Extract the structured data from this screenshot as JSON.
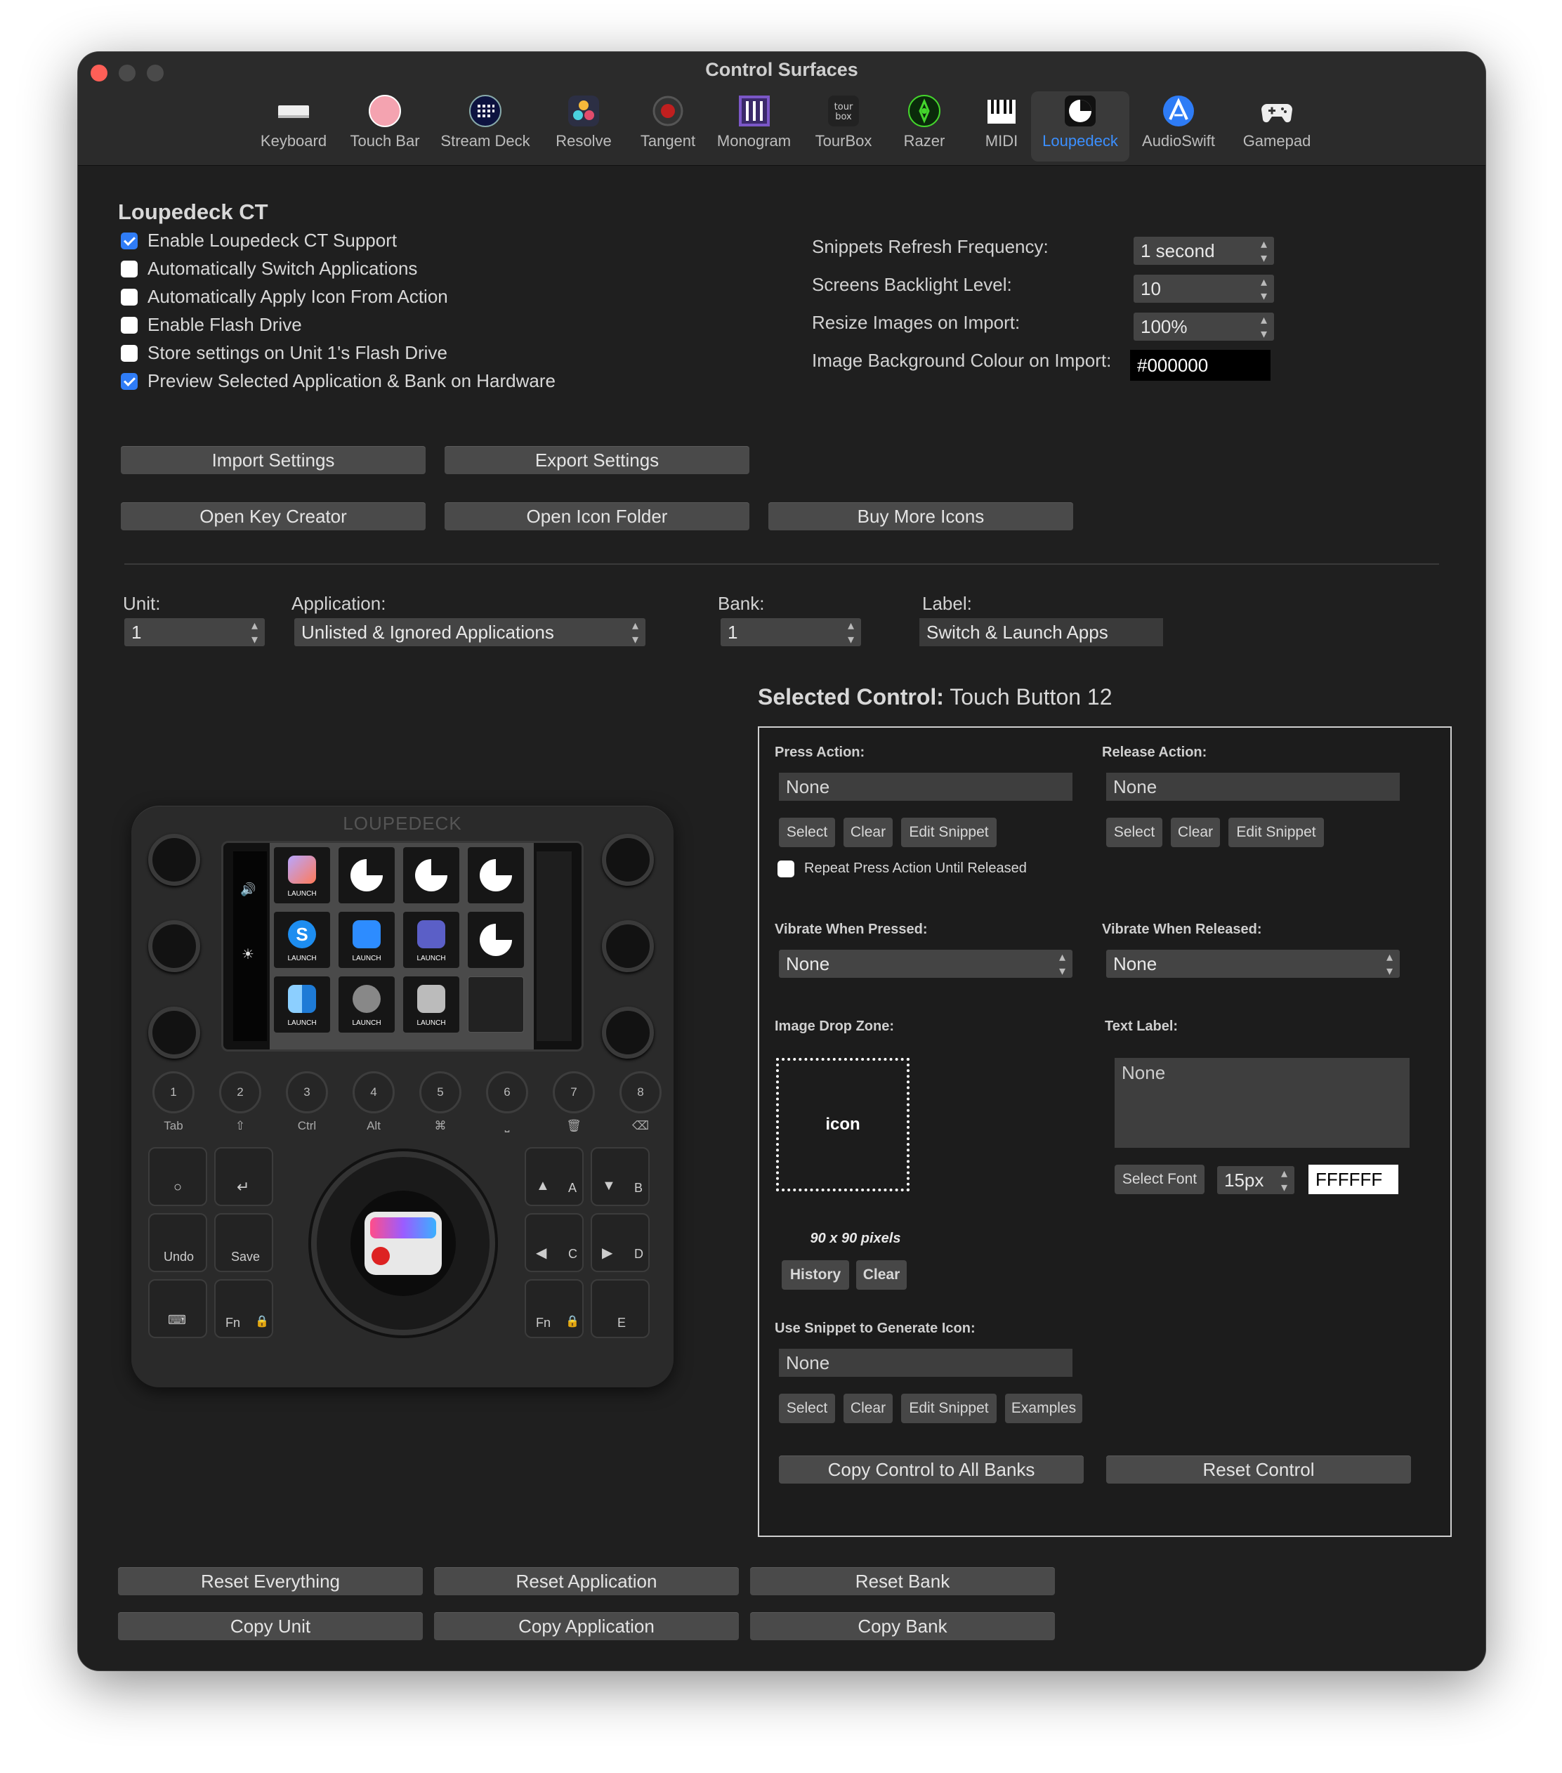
{
  "window": {
    "title": "Control Surfaces"
  },
  "toolbar": {
    "items": [
      {
        "label": "Keyboard",
        "icon": "keyboard-icon"
      },
      {
        "label": "Touch Bar",
        "icon": "touch-bar-icon"
      },
      {
        "label": "Stream Deck",
        "icon": "stream-deck-icon"
      },
      {
        "label": "Resolve",
        "icon": "resolve-icon"
      },
      {
        "label": "Tangent",
        "icon": "tangent-icon"
      },
      {
        "label": "Monogram",
        "icon": "monogram-icon"
      },
      {
        "label": "TourBox",
        "icon": "tourbox-icon"
      },
      {
        "label": "Razer",
        "icon": "razer-icon"
      },
      {
        "label": "MIDI",
        "icon": "midi-icon"
      },
      {
        "label": "Loupedeck",
        "icon": "loupedeck-icon",
        "selected": true
      },
      {
        "label": "AudioSwift",
        "icon": "audioswift-icon"
      },
      {
        "label": "Gamepad",
        "icon": "gamepad-icon"
      }
    ],
    "selected_color": "#3b8fff"
  },
  "section": {
    "title": "Loupedeck CT"
  },
  "checkboxes": [
    {
      "label": "Enable Loupedeck CT Support",
      "checked": true
    },
    {
      "label": "Automatically Switch Applications",
      "checked": false
    },
    {
      "label": "Automatically Apply Icon From Action",
      "checked": false
    },
    {
      "label": "Enable Flash Drive",
      "checked": false
    },
    {
      "label": "Store settings on Unit 1's Flash Drive",
      "checked": false
    },
    {
      "label": "Preview Selected Application & Bank on Hardware",
      "checked": true
    }
  ],
  "settings": {
    "refresh_label": "Snippets Refresh Frequency:",
    "refresh_value": "1 second",
    "backlight_label": "Screens Backlight Level:",
    "backlight_value": "10",
    "resize_label": "Resize Images on Import:",
    "resize_value": "100%",
    "bg_label": "Image Background Colour on Import:",
    "bg_value": "#000000"
  },
  "buttons": {
    "import": "Import Settings",
    "export": "Export Settings",
    "key_creator": "Open Key Creator",
    "icon_folder": "Open Icon Folder",
    "buy_icons": "Buy More Icons"
  },
  "selectors": {
    "unit_label": "Unit:",
    "unit_value": "1",
    "app_label": "Application:",
    "app_value": "Unlisted & Ignored Applications",
    "bank_label": "Bank:",
    "bank_value": "1",
    "label_label": "Label:",
    "label_value": "Switch & Launch Apps"
  },
  "selected_control": {
    "prefix": "Selected Control:",
    "name": "Touch Button 12"
  },
  "panel": {
    "press_label": "Press Action:",
    "press_value": "None",
    "release_label": "Release Action:",
    "release_value": "None",
    "select": "Select",
    "clear": "Clear",
    "edit_snippet": "Edit Snippet",
    "repeat_label": "Repeat Press Action Until Released",
    "vib_pressed_label": "Vibrate When Pressed:",
    "vib_pressed_value": "None",
    "vib_released_label": "Vibrate When Released:",
    "vib_released_value": "None",
    "drop_label": "Image Drop Zone:",
    "drop_text": "icon",
    "drop_size": "90 x 90 pixels",
    "history": "History",
    "text_label": "Text Label:",
    "text_value": "None",
    "select_font": "Select Font",
    "font_size": "15px",
    "font_color": "FFFFFF",
    "snippet_icon_label": "Use Snippet to Generate Icon:",
    "snippet_icon_value": "None",
    "examples": "Examples",
    "copy_all_banks": "Copy Control to All Banks",
    "reset_control": "Reset Control"
  },
  "bottom": {
    "reset_everything": "Reset Everything",
    "reset_application": "Reset Application",
    "reset_bank": "Reset Bank",
    "copy_unit": "Copy Unit",
    "copy_application": "Copy Application",
    "copy_bank": "Copy Bank"
  },
  "device": {
    "brand": "LOUPEDECK",
    "launch": "LAUNCH",
    "round_buttons": [
      "1",
      "2",
      "3",
      "4",
      "5",
      "6",
      "7",
      "8"
    ],
    "round_labels": [
      "Tab",
      "⇧",
      "Ctrl",
      "Alt",
      "⌘",
      "⎵",
      "🗑",
      "⌫"
    ],
    "undo": "Undo",
    "save": "Save",
    "fn": "Fn",
    "a": "A",
    "b": "B",
    "c": "C",
    "d": "D",
    "e": "E"
  }
}
